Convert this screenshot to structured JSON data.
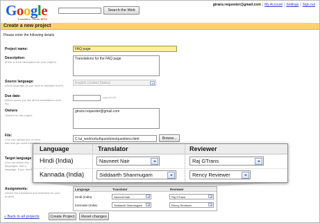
{
  "header": {
    "logo_text": "Google",
    "logo_subtitle": "Translation Center",
    "logo_beta": "BETA",
    "search_button": "Search the Web",
    "user_email": "gtrans.requester@gmail.com",
    "links": {
      "account": "My Account",
      "settings": "Settings",
      "sign_out": "Sign out"
    },
    "separator": "|"
  },
  "page": {
    "title": "Create a new project",
    "intro": "Please enter the following details"
  },
  "form": {
    "project_name": {
      "label": "Project name:",
      "value": "FAQ page"
    },
    "description": {
      "label": "Description:",
      "hint": "(Enter a short description for your project)",
      "value": "Translations for the FAQ page"
    },
    "source_language": {
      "label": "Source language:",
      "hint": "(What language do you want to translate from?)",
      "value": "English (United States)"
    },
    "due_date": {
      "label": "Due date:",
      "hint": "(When would you like all the translations done by)",
      "format_hint": "yyyy-mm-dd"
    },
    "owners": {
      "label": "Owners",
      "hint": "Owners for the project.",
      "value": "gtrans.requester@gmail.com"
    },
    "file": {
      "label": "File:",
      "hint": "(You can upload one or more files that you want translated. Files are supported (not exceed 1MB))",
      "value": "C:\\ui_work\\orkut\\questions\\questions.html",
      "browse_button": "Browse..."
    },
    "target_language": {
      "label": "Target language",
      "hint": "(You can select any languages. Add a language. If you find it in the list)"
    },
    "assignments": {
      "label": "Assignments:",
      "hint": "(Select the translators and reviewers for your project)"
    }
  },
  "assignments_table": {
    "headers": [
      "Language",
      "Translator",
      "Reviewer"
    ],
    "rows": [
      {
        "language": "Hindi (India)",
        "translator": "Navneet Nair",
        "reviewer": "Raj GTrans"
      },
      {
        "language": "Kannada (India)",
        "translator": "Siddaarth Shanmugam",
        "reviewer": "Rency Reviewer"
      }
    ]
  },
  "footer": {
    "back_link": "« Back to all projects",
    "create_button": "Create Project",
    "reset_button": "Reset changes"
  },
  "colors": {
    "title_bar": "#fcd36b",
    "link": "#2a39c8",
    "highlight_field": "#ffef9a"
  }
}
